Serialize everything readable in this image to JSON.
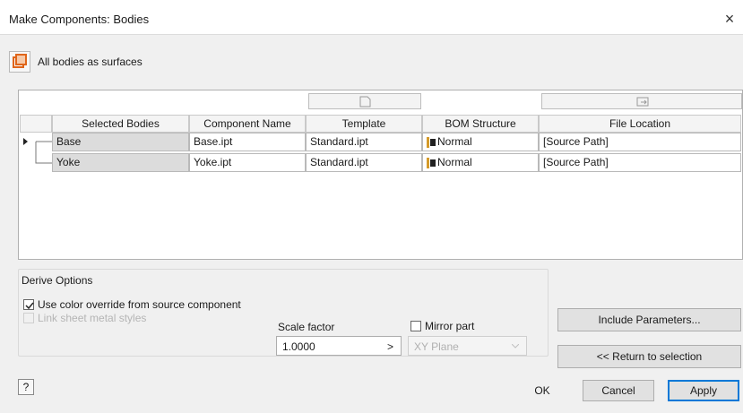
{
  "window": {
    "title": "Make Components: Bodies",
    "close_glyph": "×"
  },
  "toolbar": {
    "surfaces_label": "All bodies as surfaces"
  },
  "table": {
    "columns": [
      "Selected Bodies",
      "Component Name",
      "Template",
      "BOM Structure",
      "File Location"
    ],
    "rows": [
      {
        "body": "Base",
        "component": "Base.ipt",
        "template": "Standard.ipt",
        "bom": "Normal",
        "location": "[Source Path]"
      },
      {
        "body": "Yoke",
        "component": "Yoke.ipt",
        "template": "Standard.ipt",
        "bom": "Normal",
        "location": "[Source Path]"
      }
    ]
  },
  "derive": {
    "title": "Derive Options",
    "use_color_override": "Use color override from source component",
    "link_sheet_metal": "Link sheet metal styles",
    "scale_factor_label": "Scale factor",
    "scale_factor_value": "1.0000",
    "scale_factor_arrow": ">",
    "mirror_label": "Mirror part",
    "plane_value": "XY Plane"
  },
  "buttons": {
    "include_params": "Include Parameters...",
    "return_selection": "<< Return to selection",
    "ok": "OK",
    "cancel": "Cancel",
    "apply": "Apply"
  },
  "icons": {
    "help": "?"
  },
  "colors": {
    "selected_cell": "#dcdcdc",
    "accent": "#0078d7",
    "surface_icon": "#e0651a"
  }
}
